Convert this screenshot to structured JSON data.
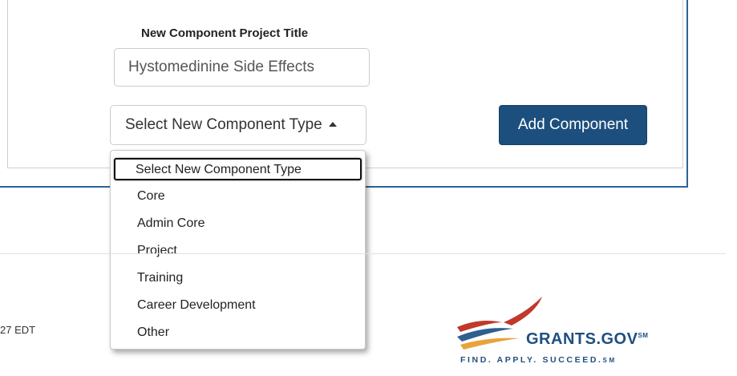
{
  "form": {
    "title_label": "New Component Project Title",
    "title_value": "Hystomedinine Side Effects",
    "type_select_label": "Select New Component Type",
    "add_button_label": "Add Component"
  },
  "dropdown": {
    "options": [
      "Select New Component Type",
      "Core",
      "Admin Core",
      "Project",
      "Training",
      "Career Development",
      "Other"
    ],
    "selected_index": 0
  },
  "footer": {
    "timestamp_fragment": "27 EDT",
    "logo": {
      "name": "GRANTS.GOV",
      "name_mark": "SM",
      "tagline": "FIND. APPLY. SUCCEED.",
      "tagline_mark": "SM"
    }
  },
  "colors": {
    "accent_blue": "#1c4f7e",
    "panel_border": "#2a6496",
    "logo_blue": "#1f4f80",
    "logo_red": "#c0392b",
    "logo_orange": "#e8a33d"
  },
  "icons": {
    "select_caret": "caret-up-icon"
  }
}
